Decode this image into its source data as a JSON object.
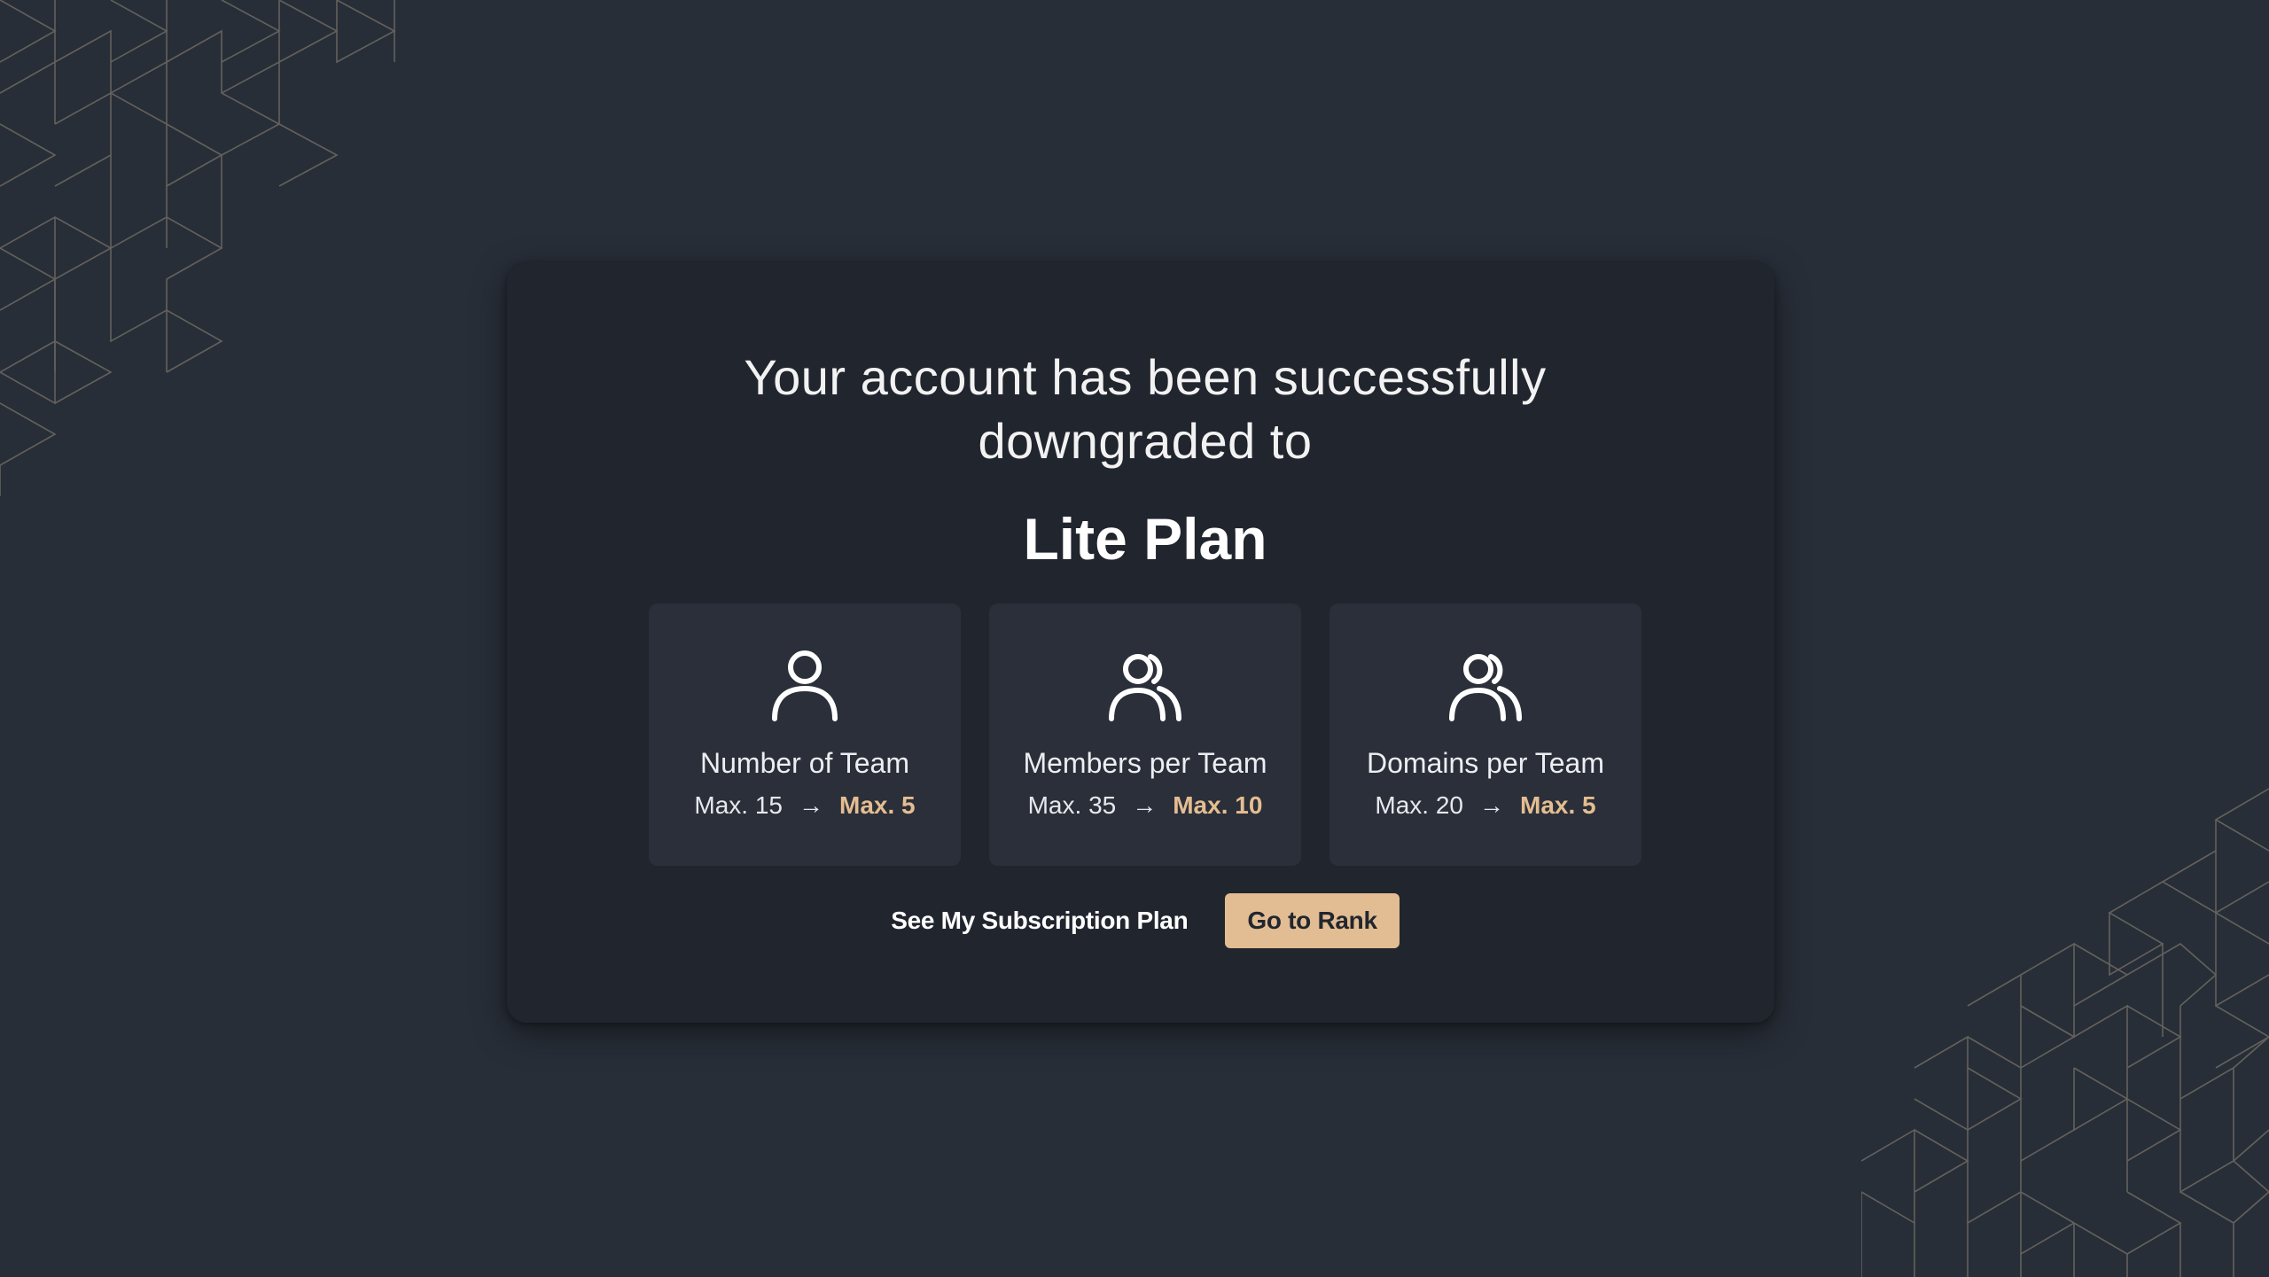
{
  "dialog": {
    "headline_line1": "Your account has been successfully",
    "headline_line2": "downgraded to",
    "plan_name": "Lite Plan"
  },
  "limits": [
    {
      "icon": "user-icon",
      "label": "Number of Team",
      "from": "Max. 15",
      "to": "Max. 5"
    },
    {
      "icon": "users-icon",
      "label": "Members per Team",
      "from": "Max. 35",
      "to": "Max. 10"
    },
    {
      "icon": "users-icon",
      "label": "Domains per Team",
      "from": "Max. 20",
      "to": "Max. 5"
    }
  ],
  "actions": {
    "secondary_label": "See My Subscription Plan",
    "primary_label": "Go to Rank"
  },
  "colors": {
    "background": "#282e38",
    "card": "#21252e",
    "tile": "#2a2f39",
    "accent": "#e2bd93"
  }
}
